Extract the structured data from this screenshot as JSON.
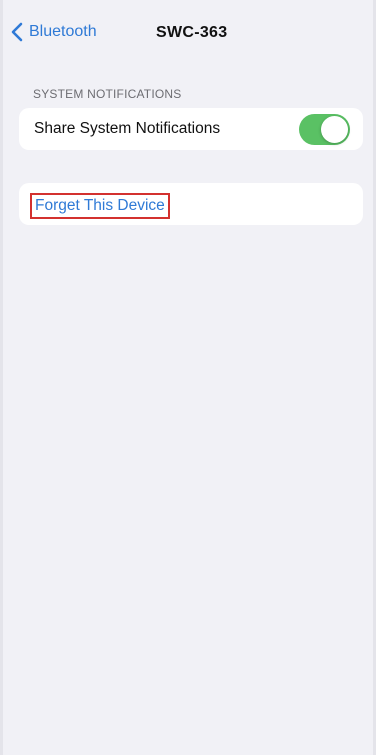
{
  "navbar": {
    "back_label": "Bluetooth",
    "title": "SWC-363"
  },
  "system_notifications": {
    "section_header": "SYSTEM NOTIFICATIONS",
    "share_label": "Share System Notifications",
    "share_enabled": true
  },
  "device_actions": {
    "forget_label": "Forget This Device"
  },
  "colors": {
    "accent": "#2f7ad6",
    "toggle_on": "#5ac164",
    "background": "#f1f1f6",
    "highlight_box": "#d3312f"
  },
  "icons": {
    "back": "chevron-left-icon"
  }
}
